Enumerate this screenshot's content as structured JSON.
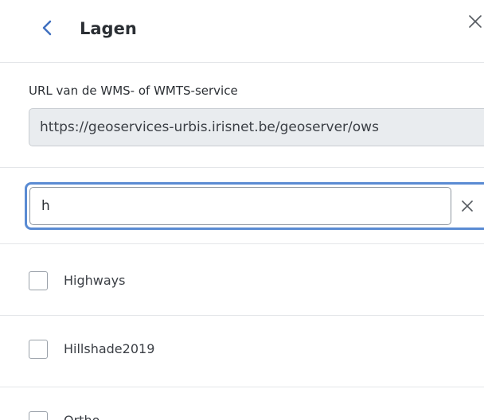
{
  "header": {
    "title": "Lagen",
    "back_icon": "chevron-left-icon",
    "close_icon": "close-icon"
  },
  "url_section": {
    "label": "URL van de WMS- of WMTS-service",
    "value": "https://geoservices-urbis.irisnet.be/geoserver/ows"
  },
  "search": {
    "value": "h",
    "clear_icon": "close-icon"
  },
  "layers": [
    {
      "label": "Highways",
      "checked": false
    },
    {
      "label": "Hillshade2019",
      "checked": false
    },
    {
      "label": "Ortho",
      "checked": false
    }
  ],
  "colors": {
    "accent": "#3f6fbf",
    "focus_ring": "#5a8bd3",
    "divider": "#e4e6e9",
    "disabled_field": "#e9ecef"
  }
}
